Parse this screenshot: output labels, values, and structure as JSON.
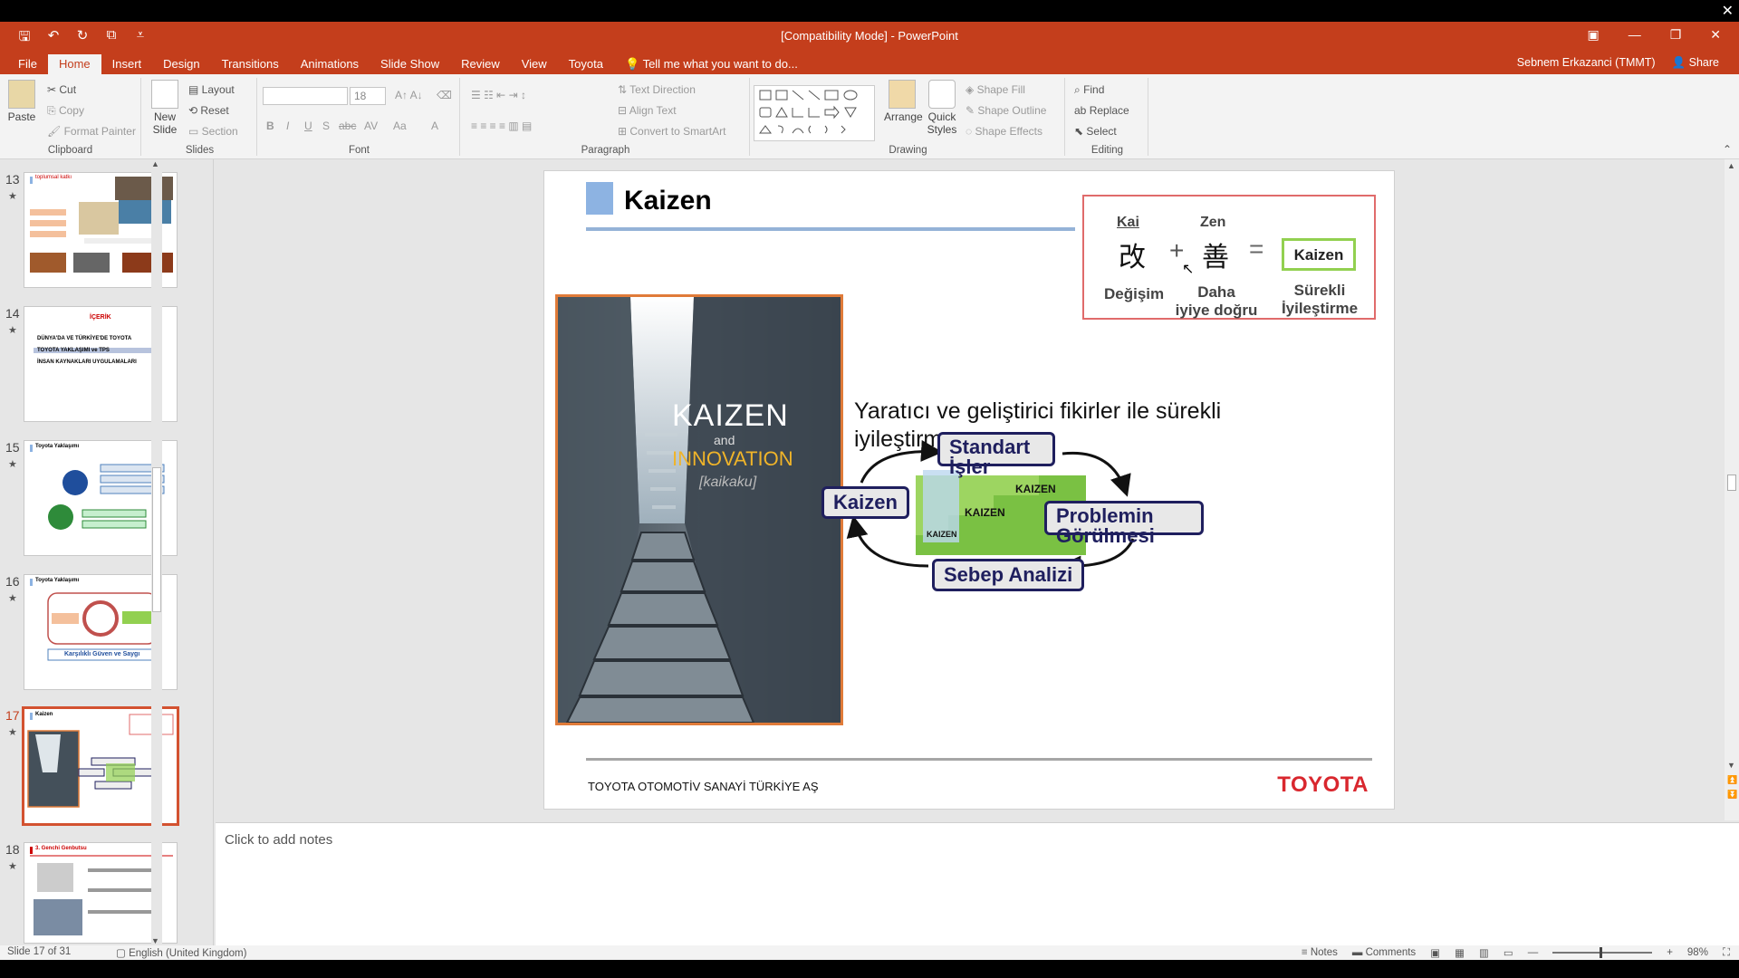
{
  "window": {
    "title": "[Compatibility Mode] - PowerPoint",
    "user": "Sebnem Erkazanci (TMMT)",
    "share": "Share",
    "tell_me": "Tell me what you want to do..."
  },
  "tabs": [
    "File",
    "Home",
    "Insert",
    "Design",
    "Transitions",
    "Animations",
    "Slide Show",
    "Review",
    "View",
    "Toyota"
  ],
  "ribbon": {
    "clipboard": {
      "paste": "Paste",
      "cut": "Cut",
      "copy": "Copy",
      "format_painter": "Format Painter",
      "label": "Clipboard"
    },
    "slides": {
      "new_slide": "New",
      "new_slide2": "Slide",
      "layout": "Layout",
      "reset": "Reset",
      "section": "Section",
      "label": "Slides"
    },
    "font": {
      "size": "18",
      "label": "Font",
      "bold": "B",
      "italic": "I",
      "underline": "U",
      "shadow": "S",
      "strike": "abc",
      "spacing": "AV",
      "case": "Aa",
      "color": "A"
    },
    "paragraph": {
      "text_direction": "Text Direction",
      "align_text": "Align Text",
      "smartart": "Convert to SmartArt",
      "label": "Paragraph"
    },
    "drawing": {
      "arrange": "Arrange",
      "quick_styles": "Quick",
      "quick_styles2": "Styles",
      "shape_fill": "Shape Fill",
      "shape_outline": "Shape Outline",
      "shape_effects": "Shape Effects",
      "label": "Drawing"
    },
    "editing": {
      "find": "Find",
      "replace": "Replace",
      "select": "Select",
      "label": "Editing"
    }
  },
  "thumbnails": [
    {
      "num": "13",
      "title": "toplumsal katkı",
      "active": false
    },
    {
      "num": "14",
      "title": "İÇERİK",
      "active": false
    },
    {
      "num": "15",
      "title": "Toyota Yaklaşımı",
      "active": false
    },
    {
      "num": "16",
      "title": "Toyota Yaklaşımı",
      "active": false
    },
    {
      "num": "17",
      "title": "Kaizen",
      "active": true
    },
    {
      "num": "18",
      "title": "3. Genchi Genbutsu",
      "active": false
    }
  ],
  "thumb14_items": [
    "DÜNYA'DA VE TÜRKİYE'DE TOYOTA",
    "TOYOTA YAKLAŞIMI ve TPS",
    "İNSAN KAYNAKLARI UYGULAMALARI"
  ],
  "thumb16_caption": "Karşılıklı Güven ve Saygı",
  "slide": {
    "title": "Kaizen",
    "def": {
      "kai": "Kai",
      "zen": "Zen",
      "kai_kanji": "改",
      "zen_kanji": "善",
      "plus": "+",
      "equals": "=",
      "kai_meaning": "Değişim",
      "zen_meaning_1": "Daha",
      "zen_meaning_2": "iyiye doğru",
      "result": "Kaizen",
      "result_meaning_1": "Sürekli",
      "result_meaning_2": "İyileştirme"
    },
    "photo": {
      "line1": "KAIZEN",
      "line2": "and",
      "line3": "INNOVATION",
      "line4": "[kaikaku]"
    },
    "description": "Yaratıcı ve geliştirici fikirler ile sürekli iyileştirme",
    "cycle": {
      "standart_1": "Standart",
      "standart_2": "İşler",
      "kaizen": "Kaizen",
      "problem_1": "Problemin",
      "problem_2": "Görülmesi",
      "sebep": "Sebep Analizi",
      "step_label": "KAIZEN"
    },
    "footer_text": "TOYOTA OTOMOTİV SANAYİ TÜRKİYE AŞ",
    "footer_logo": "TOYOTA"
  },
  "notes_placeholder": "Click to add notes",
  "status": {
    "slide_info": "Slide 17 of 31",
    "language": "English (United Kingdom)",
    "notes": "Notes",
    "comments": "Comments",
    "zoom": "98%"
  },
  "colors": {
    "accent": "#c43e1c",
    "selection": "#d35230",
    "title_bar": "#95b3d7",
    "toyota_red": "#d9272e"
  }
}
